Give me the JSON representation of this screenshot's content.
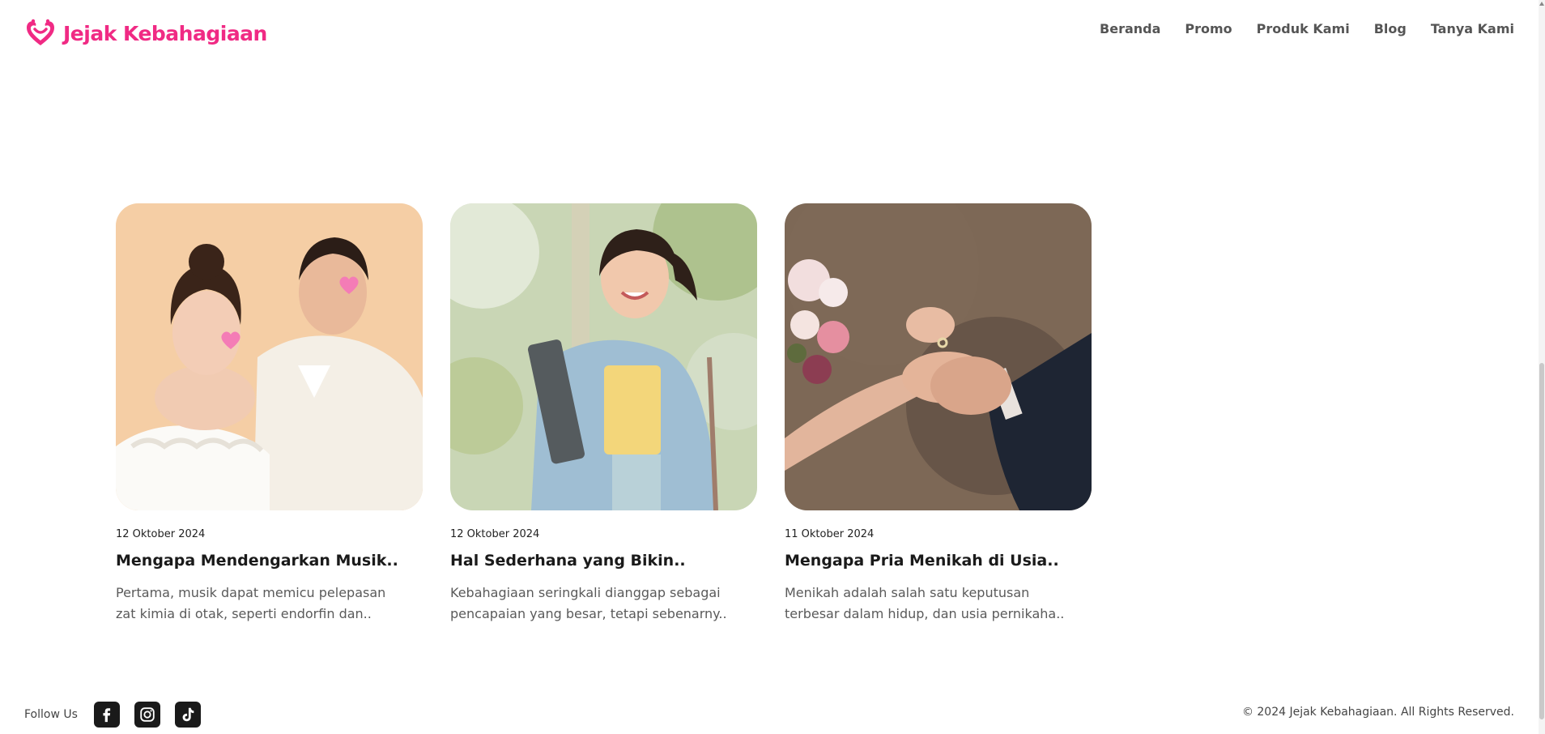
{
  "brand": {
    "name": "Jejak Kebahagiaan",
    "color": "#f02a84"
  },
  "nav": [
    {
      "label": "Beranda"
    },
    {
      "label": "Promo"
    },
    {
      "label": "Produk Kami"
    },
    {
      "label": "Blog"
    },
    {
      "label": "Tanya Kami"
    }
  ],
  "posts": [
    {
      "date": "12 Oktober 2024",
      "title": "Mengapa Mendengarkan Musik..",
      "excerpt_line1": "Pertama, musik dapat memicu pelepasan",
      "excerpt_line2": "zat kimia di otak, seperti endorfin dan..",
      "image": "couple-with-paper-hearts"
    },
    {
      "date": "12 Oktober 2024",
      "title": "Hal Sederhana yang Bikin..",
      "excerpt_line1": "Kebahagiaan seringkali dianggap sebagai",
      "excerpt_line2": "pencapaian yang besar, tetapi sebenarny..",
      "image": "smiling-woman-outdoors"
    },
    {
      "date": "11 Oktober 2024",
      "title": "Mengapa Pria Menikah di Usia..",
      "excerpt_line1": "Menikah adalah salah satu keputusan",
      "excerpt_line2": "terbesar dalam hidup, dan usia pernikaha..",
      "image": "holding-hands-with-ring"
    }
  ],
  "footer": {
    "follow_label": "Follow Us",
    "socials": [
      "facebook-icon",
      "instagram-icon",
      "tiktok-icon"
    ],
    "copyright": "© 2024 Jejak Kebahagiaan. All Rights Reserved."
  }
}
